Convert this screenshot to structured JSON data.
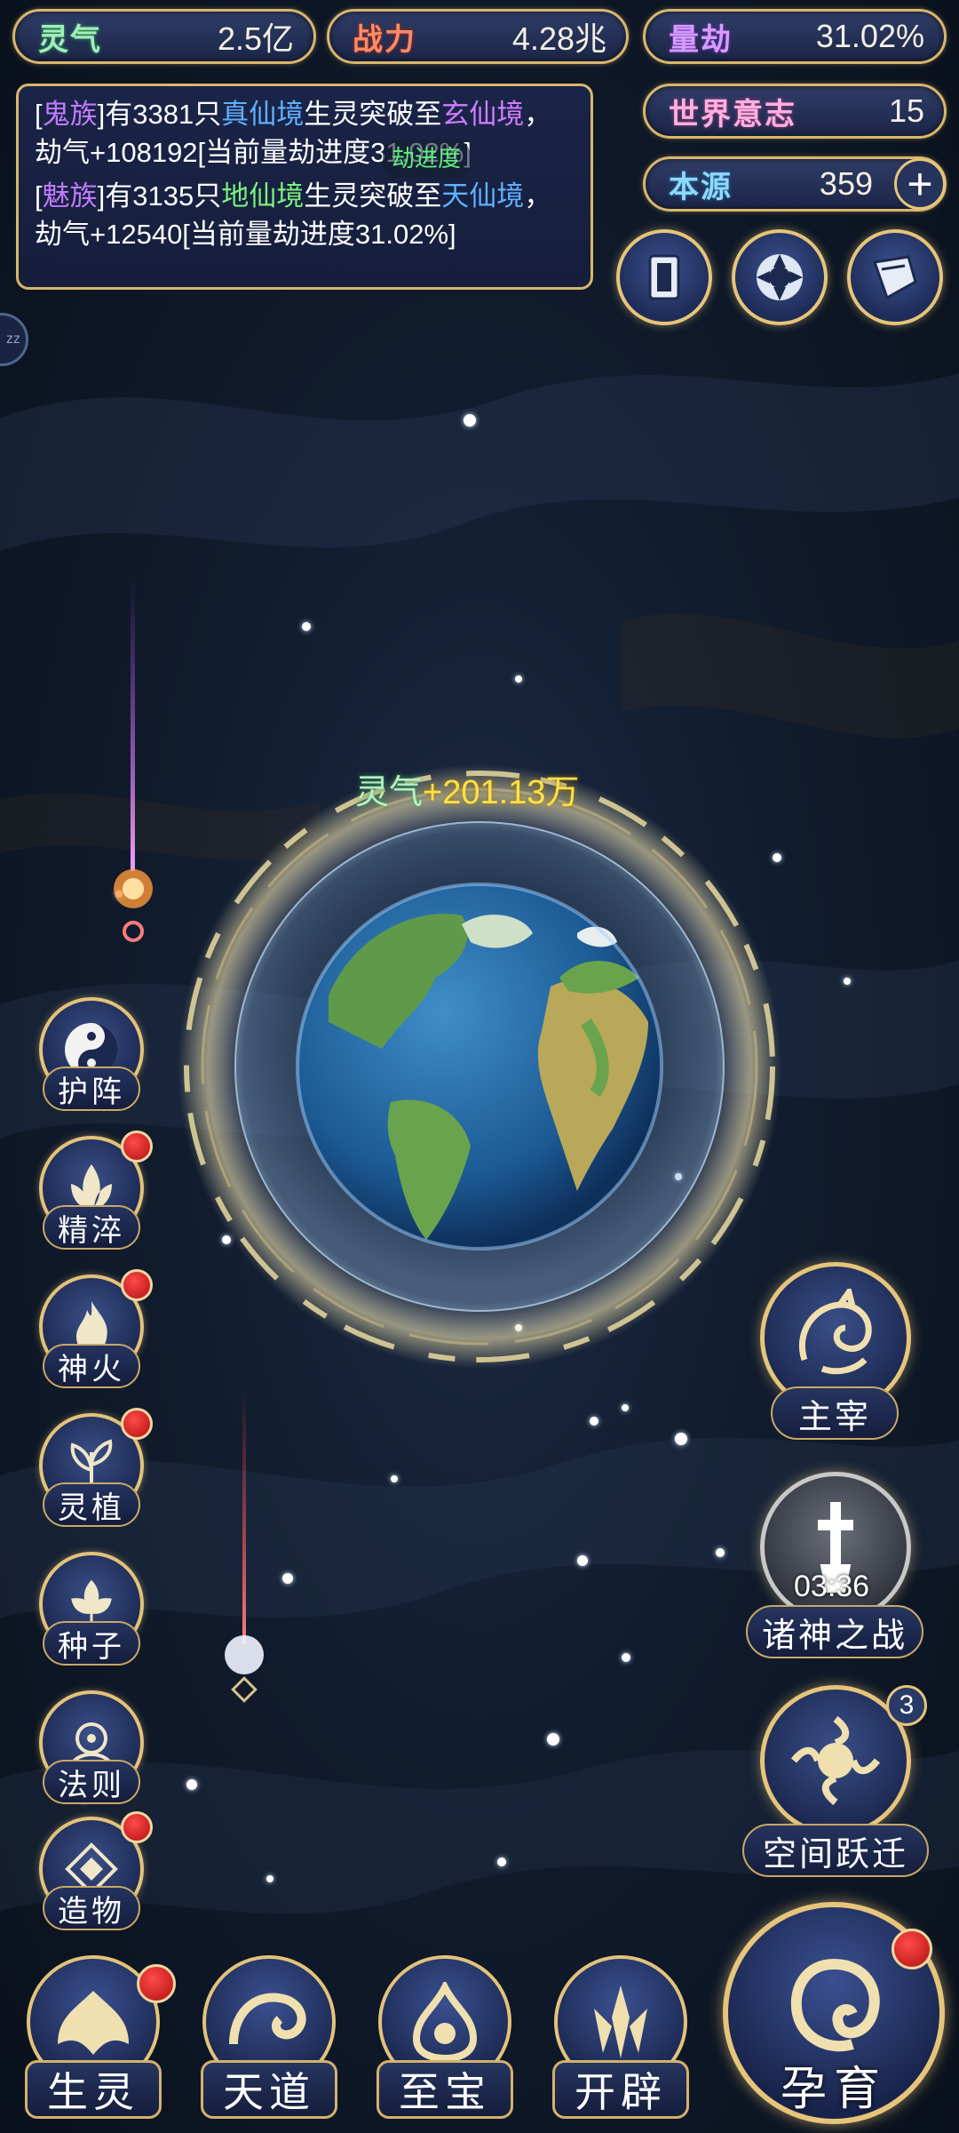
{
  "stats": {
    "lingqi": {
      "label": "灵气",
      "value": "2.5亿"
    },
    "zhanli": {
      "label": "战力",
      "value": "4.28兆"
    },
    "liangjie": {
      "label": "量劫",
      "value": "31.02%"
    },
    "shijie": {
      "label": "世界意志",
      "value": "15"
    },
    "benyuan": {
      "label": "本源",
      "value": "359",
      "add": "+"
    }
  },
  "log": {
    "entries": [
      {
        "bracket_open": "[",
        "clan": "鬼族",
        "bracket_close": "]",
        "t1": "有3381只",
        "realm": "真仙境",
        "t2": "生灵突破至",
        "target": "玄仙境",
        "t3": "，劫气+108192[当前量劫进度31.02%]"
      },
      {
        "bracket_open": "[",
        "clan": "魅族",
        "bracket_close": "]",
        "t1": "有3135只",
        "realm": "地仙境",
        "t2": "生灵突破至",
        "target": "天仙境",
        "t3": "，劫气+12540[当前量劫进度31.02%]"
      }
    ],
    "overlay": "劫进度"
  },
  "side_tab": "zz",
  "gain": {
    "label": "灵气",
    "value": "+201.13万"
  },
  "skills": [
    "护阵",
    "精淬",
    "神火",
    "灵植",
    "种子",
    "法则",
    "造物"
  ],
  "right": {
    "zhuzai": "主宰",
    "zhushen": "诸神之战",
    "zhushen_timer": "03:36",
    "kongjian": "空间跃迁",
    "kongjian_badge": "3"
  },
  "nav": [
    "生灵",
    "天道",
    "至宝",
    "开辟"
  ],
  "main_nav": "孕育",
  "colors": {
    "gold": "#d9b66a",
    "panel": "#1b2547",
    "alert": "#d01818"
  }
}
